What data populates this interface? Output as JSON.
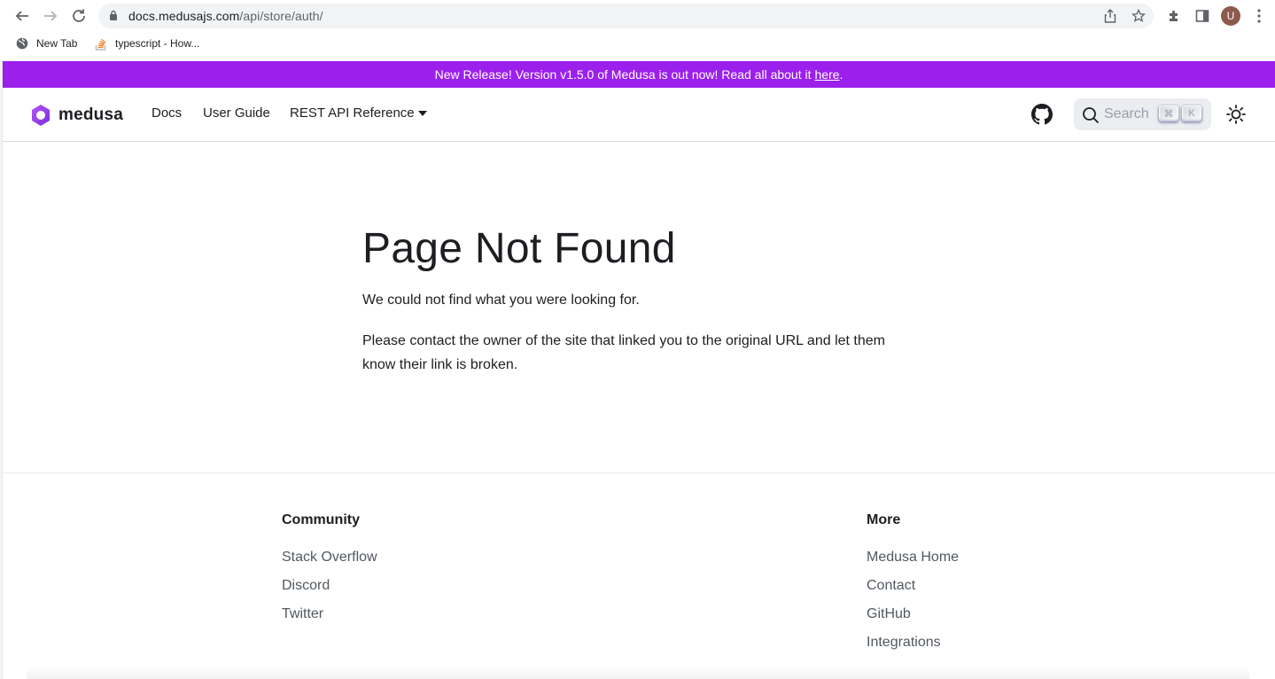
{
  "browser": {
    "url_domain": "docs.medusajs.com",
    "url_path": "/api/store/auth/",
    "avatar_initial": "U",
    "bookmarks": [
      {
        "label": "New Tab",
        "icon": "globe-icon"
      },
      {
        "label": "typescript - How...",
        "icon": "stackoverflow-icon"
      }
    ]
  },
  "announcement": {
    "text": "New Release! Version v1.5.0 of Medusa is out now! Read all about it",
    "link_label": "here",
    "suffix": ".",
    "color": "#9c20ec"
  },
  "navbar": {
    "logo_text": "medusa",
    "links": [
      "Docs",
      "User Guide",
      "REST API Reference"
    ],
    "search_placeholder": "Search",
    "search_keys": [
      "⌘",
      "K"
    ]
  },
  "main": {
    "title": "Page Not Found",
    "paragraph1": "We could not find what you were looking for.",
    "paragraph2": "Please contact the owner of the site that linked you to the original URL and let them know their link is broken."
  },
  "footer": {
    "community": {
      "title": "Community",
      "links": [
        "Stack Overflow",
        "Discord",
        "Twitter"
      ]
    },
    "more": {
      "title": "More",
      "links": [
        "Medusa Home",
        "Contact",
        "GitHub",
        "Integrations"
      ]
    }
  }
}
